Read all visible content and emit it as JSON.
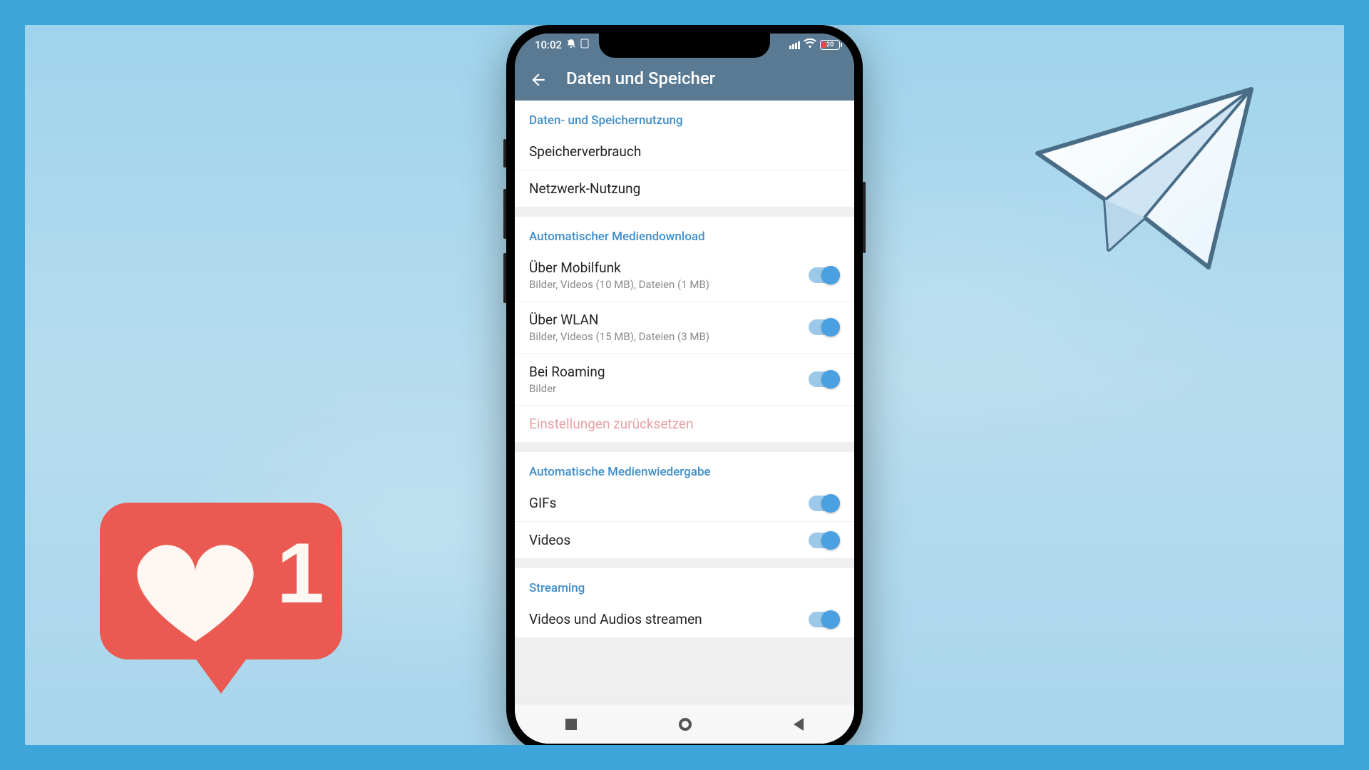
{
  "status": {
    "time": "10:02",
    "battery_pct": "20"
  },
  "header": {
    "title": "Daten und Speicher"
  },
  "sections": {
    "storage": {
      "header": "Daten- und Speichernutzung",
      "storage_usage": "Speicherverbrauch",
      "network_usage": "Netzwerk-Nutzung"
    },
    "auto_dl": {
      "header": "Automatischer Mediendownload",
      "mobile": {
        "title": "Über Mobilfunk",
        "sub": "Bilder, Videos (10 MB), Dateien (1 MB)"
      },
      "wlan": {
        "title": "Über WLAN",
        "sub": "Bilder, Videos (15 MB), Dateien (3 MB)"
      },
      "roaming": {
        "title": "Bei Roaming",
        "sub": "Bilder"
      },
      "reset": "Einstellungen zurücksetzen"
    },
    "auto_play": {
      "header": "Automatische Medienwiedergabe",
      "gifs": "GIFs",
      "videos": "Videos"
    },
    "streaming": {
      "header": "Streaming",
      "stream_av": "Videos und Audios streamen"
    }
  },
  "like": {
    "count": "1"
  },
  "colors": {
    "accent": "#3f8ecb",
    "appbar": "#5a7a94",
    "switch_on_track": "#9cc9ea",
    "switch_on_knob": "#4aa0e0",
    "like_bubble": "#ea5a52"
  }
}
